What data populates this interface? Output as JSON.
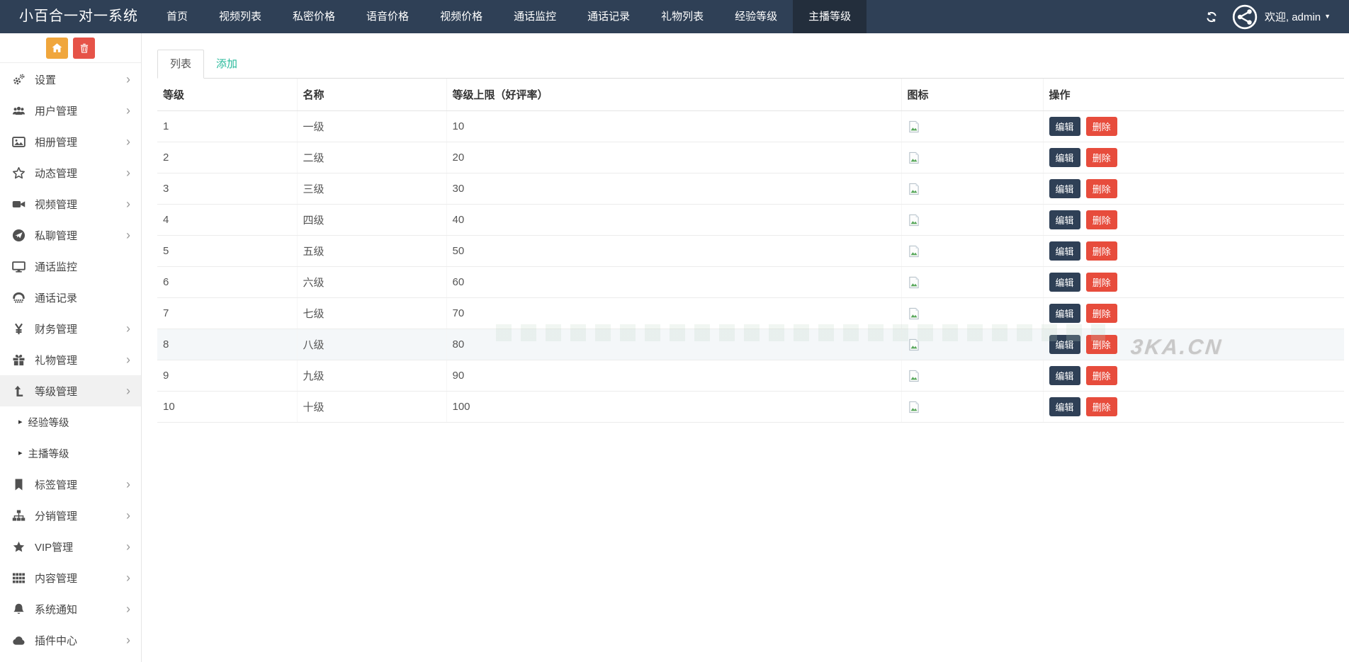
{
  "navbar": {
    "brand": "小百合一对一系统",
    "items": [
      {
        "label": "首页"
      },
      {
        "label": "视频列表"
      },
      {
        "label": "私密价格"
      },
      {
        "label": "语音价格"
      },
      {
        "label": "视频价格"
      },
      {
        "label": "通话监控"
      },
      {
        "label": "通话记录"
      },
      {
        "label": "礼物列表"
      },
      {
        "label": "经验等级"
      },
      {
        "label": "主播等级",
        "active": true
      }
    ],
    "welcome": "欢迎, admin"
  },
  "sidebar": {
    "items": [
      {
        "label": "设置",
        "icon": "gears",
        "chevron": true
      },
      {
        "label": "用户管理",
        "icon": "users",
        "chevron": true
      },
      {
        "label": "相册管理",
        "icon": "image",
        "chevron": true
      },
      {
        "label": "动态管理",
        "icon": "star-o",
        "chevron": true
      },
      {
        "label": "视频管理",
        "icon": "video",
        "chevron": true
      },
      {
        "label": "私聊管理",
        "icon": "send",
        "chevron": true
      },
      {
        "label": "通话监控",
        "icon": "desktop",
        "chevron": false
      },
      {
        "label": "通话记录",
        "icon": "phone",
        "chevron": false
      },
      {
        "label": "财务管理",
        "icon": "yen",
        "chevron": true
      },
      {
        "label": "礼物管理",
        "icon": "gift",
        "chevron": true
      },
      {
        "label": "等级管理",
        "icon": "levelup",
        "chevron": true,
        "active": true,
        "children": [
          {
            "label": "经验等级"
          },
          {
            "label": "主播等级"
          }
        ]
      },
      {
        "label": "标签管理",
        "icon": "bookmark",
        "chevron": true
      },
      {
        "label": "分销管理",
        "icon": "sitemap",
        "chevron": true
      },
      {
        "label": "VIP管理",
        "icon": "star",
        "chevron": true
      },
      {
        "label": "内容管理",
        "icon": "grid",
        "chevron": true
      },
      {
        "label": "系统通知",
        "icon": "bell",
        "chevron": true
      },
      {
        "label": "插件中心",
        "icon": "cloud",
        "chevron": true
      }
    ]
  },
  "main": {
    "tabs": [
      {
        "label": "列表",
        "active": true
      },
      {
        "label": "添加",
        "active": false
      }
    ],
    "table": {
      "headers": [
        "等级",
        "名称",
        "等级上限（好评率）",
        "图标",
        "操作"
      ],
      "edit_label": "编辑",
      "delete_label": "删除",
      "rows": [
        {
          "level": "1",
          "name": "一级",
          "limit": "10"
        },
        {
          "level": "2",
          "name": "二级",
          "limit": "20"
        },
        {
          "level": "3",
          "name": "三级",
          "limit": "30"
        },
        {
          "level": "4",
          "name": "四级",
          "limit": "40"
        },
        {
          "level": "5",
          "name": "五级",
          "limit": "50"
        },
        {
          "level": "6",
          "name": "六级",
          "limit": "60"
        },
        {
          "level": "7",
          "name": "七级",
          "limit": "70"
        },
        {
          "level": "8",
          "name": "八级",
          "limit": "80",
          "hover": true
        },
        {
          "level": "9",
          "name": "九级",
          "limit": "90"
        },
        {
          "level": "10",
          "name": "十级",
          "limit": "100"
        }
      ]
    },
    "watermark": "3KA.CN"
  },
  "colors": {
    "navbar_bg": "#2f4056",
    "navbar_active_bg": "#232e3c",
    "accent_teal": "#26b99a",
    "edit_button": "#2f4056",
    "delete_button": "#e74c3c",
    "home_button": "#f0a63c",
    "trash_button": "#e65348",
    "sidebar_active_bg": "#f1f1f1",
    "row_hover_bg": "#f4f7f9"
  }
}
